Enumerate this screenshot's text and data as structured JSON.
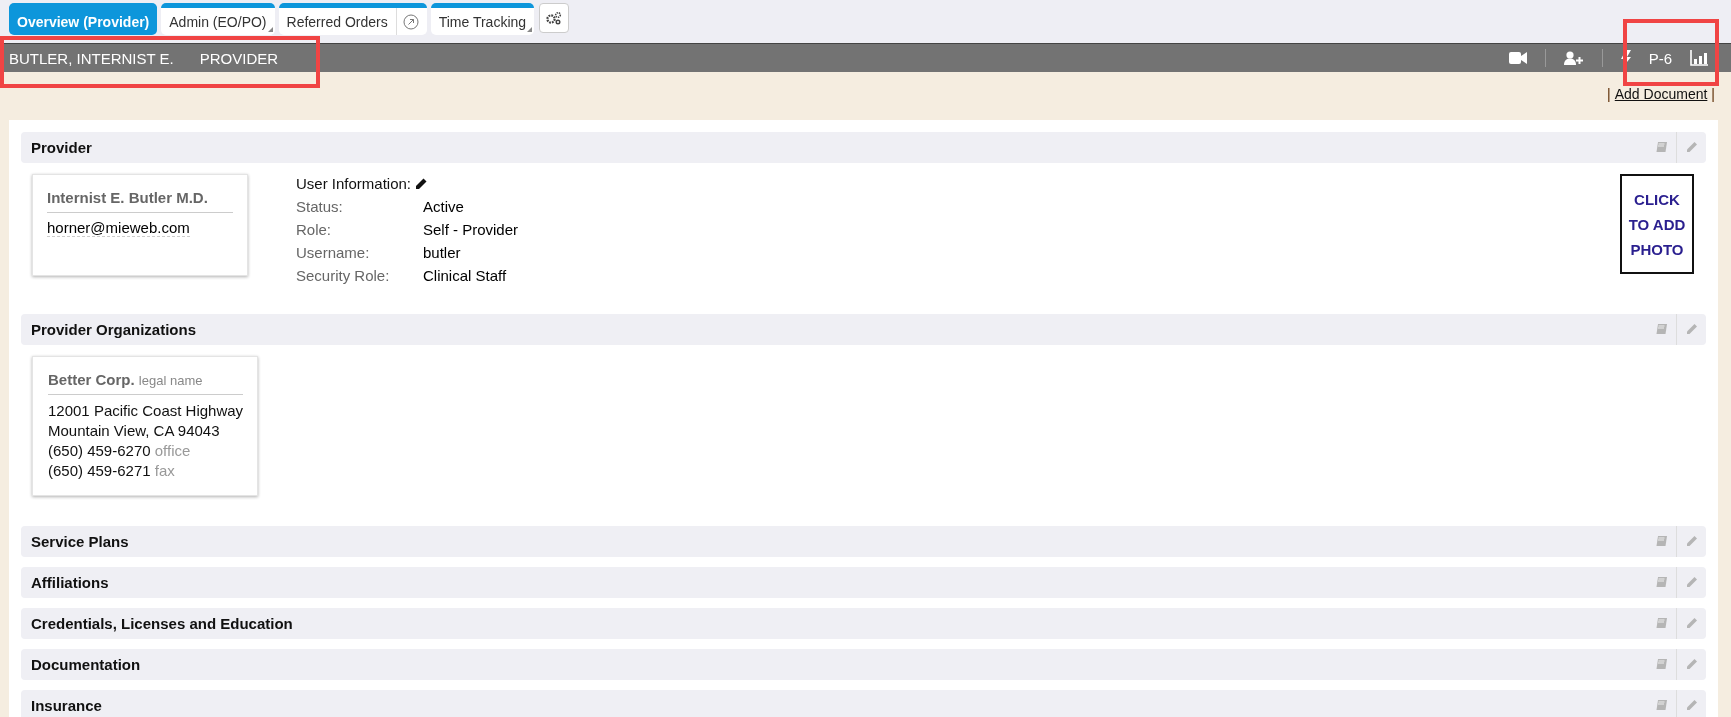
{
  "tabs": [
    {
      "label": "Overview (Provider)",
      "selected": true,
      "kind": "plain"
    },
    {
      "label": "Admin (EO/PO)",
      "selected": false,
      "kind": "dropdown"
    },
    {
      "label": "Referred Orders",
      "selected": false,
      "kind": "link"
    },
    {
      "label": "Time Tracking",
      "selected": false,
      "kind": "dropdown"
    }
  ],
  "header": {
    "name": "BUTLER, INTERNIST E.",
    "role": "PROVIDER",
    "badge": "P-6"
  },
  "add_document": {
    "prefix": "|",
    "label": "Add Document",
    "suffix": "|"
  },
  "sections": [
    {
      "title": "Provider",
      "kind": "provider",
      "card": {
        "name": "Internist E. Butler M.D.",
        "email": "horner@mieweb.com"
      },
      "user_info": {
        "title": "User Information:",
        "fields": [
          {
            "label": "Status:",
            "value": "Active"
          },
          {
            "label": "Role:",
            "value": "Self - Provider"
          },
          {
            "label": "Username:",
            "value": "butler"
          },
          {
            "label": "Security Role:",
            "value": "Clinical Staff"
          }
        ]
      },
      "photo": {
        "lines": [
          "CLICK",
          "TO ADD",
          "PHOTO"
        ]
      }
    },
    {
      "title": "Provider Organizations",
      "kind": "orgs",
      "cards": [
        {
          "name": "Better Corp.",
          "note": "legal name",
          "address": [
            "12001 Pacific Coast Highway",
            "Mountain View, CA 94043"
          ],
          "phones": [
            {
              "number": "(650) 459-6270",
              "type": "office"
            },
            {
              "number": "(650) 459-6271",
              "type": "fax"
            }
          ]
        }
      ]
    },
    {
      "title": "Service Plans",
      "kind": "collapsed"
    },
    {
      "title": "Affiliations",
      "kind": "collapsed"
    },
    {
      "title": "Credentials, Licenses and Education",
      "kind": "collapsed"
    },
    {
      "title": "Documentation",
      "kind": "collapsed"
    },
    {
      "title": "Insurance",
      "kind": "collapsed"
    }
  ]
}
